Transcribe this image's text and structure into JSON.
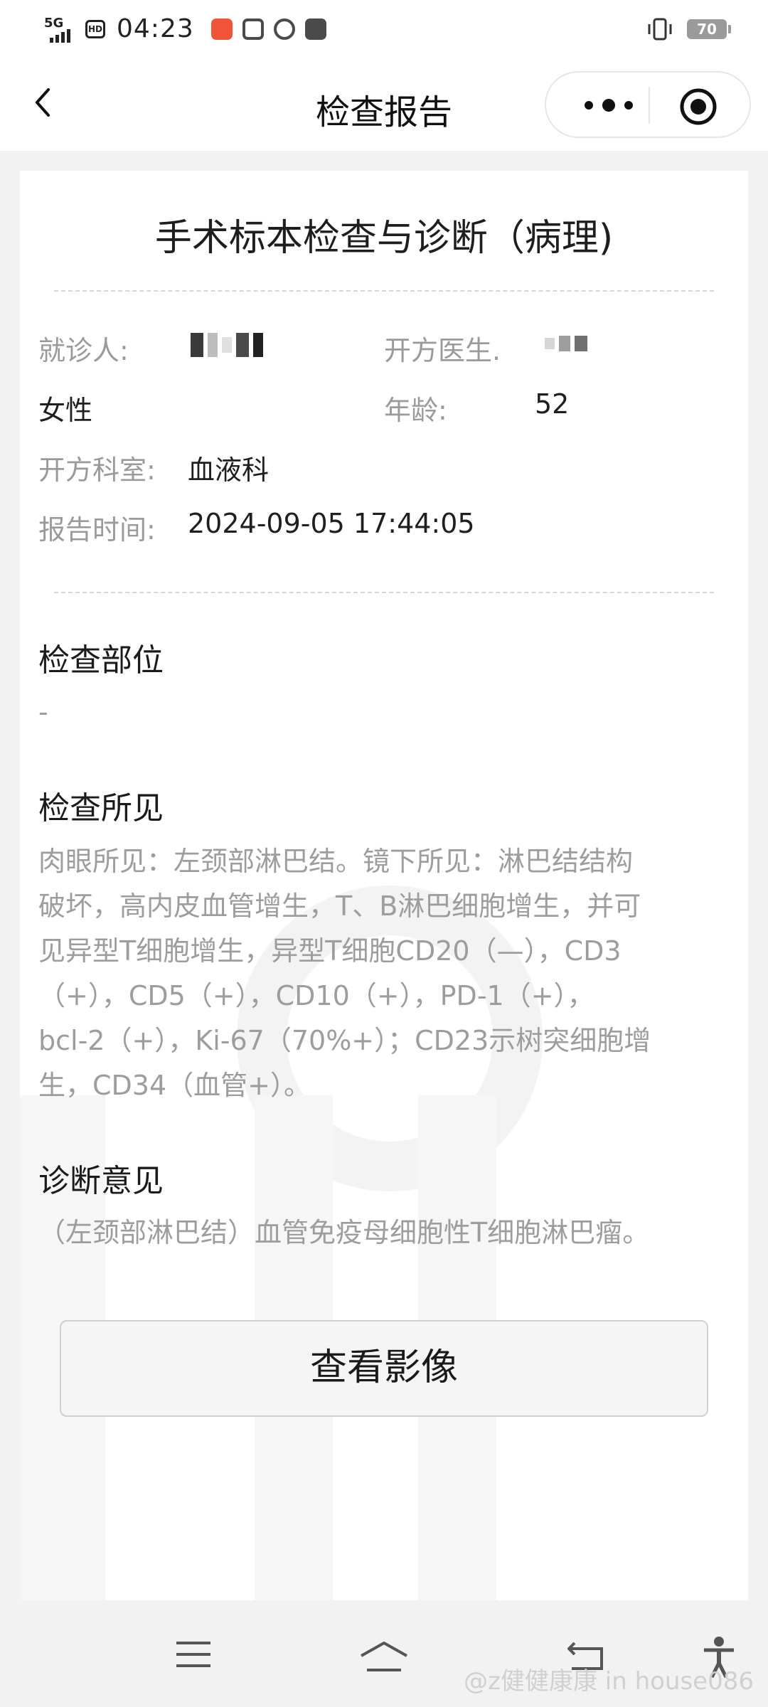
{
  "status_bar": {
    "network": "5G",
    "hd": "HD",
    "time": "04:23",
    "battery": "70",
    "app_icon_colors": [
      "#f0553a",
      "#4a4a4a",
      "#4a4a4a",
      "#4a4a4a"
    ]
  },
  "nav": {
    "title": "检查报告",
    "back_icon": "chevron-left-icon",
    "more_icon": "more-dots-icon",
    "close_icon": "target-circle-icon"
  },
  "report": {
    "title": "手术标本检查与诊断（病理)",
    "patient_label": "就诊人:",
    "doctor_label": "开方医生.",
    "gender": "女性",
    "age_label": "年龄:",
    "age_value": "52",
    "dept_label": "开方科室:",
    "dept_value": "血液科",
    "time_label": "报告时间:",
    "time_value": "2024-09-05 17:44:05"
  },
  "sections": {
    "site_title": "检查部位",
    "site_text": "-",
    "findings_title": "检查所见",
    "findings_lines": [
      "肉眼所见：左颈部淋巴结。镜下所见：淋巴结结构",
      "破坏，高内皮血管增生，T、B淋巴细胞增生，并可",
      "见异型T细胞增生，异型T细胞CD20（—），CD3",
      "（+），CD5（+），CD10（+），PD-1（+），",
      "bcl-2（+），Ki-67（70%+）；CD23示树突细胞增",
      "生，CD34（血管+）。"
    ],
    "diagnosis_title": "诊断意见",
    "diagnosis_text": "（左颈部淋巴结）血管免疫母细胞性T细胞淋巴瘤。"
  },
  "actions": {
    "view_image": "查看影像"
  },
  "bottom_bar": {
    "icons": [
      "menu-icon",
      "home-icon",
      "back-arrow-icon",
      "accessibility-icon"
    ],
    "watermark": "@z健健康康 in house086"
  }
}
